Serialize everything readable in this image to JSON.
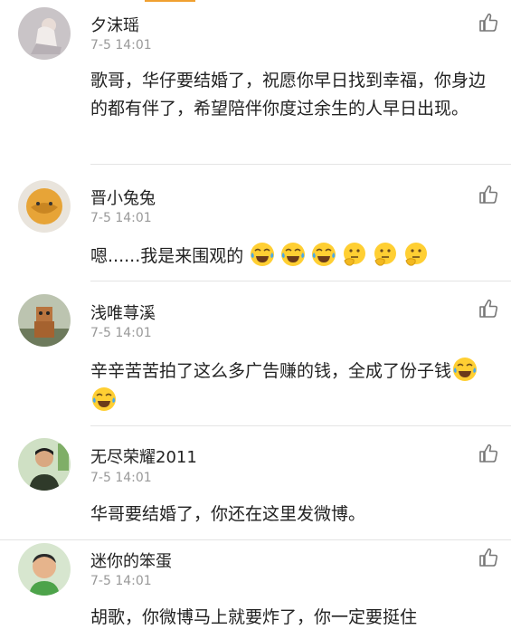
{
  "comments": [
    {
      "name": "夕沫瑶",
      "time": "7-5 14:01",
      "text": "歌哥，华仔要结婚了，祝愿你早日找到幸福，你身边的都有伴了，希望陪伴你度过余生的人早日出现。",
      "avatar_icon": "avatar-girl-sitting"
    },
    {
      "name": "晋小兔兔",
      "time": "7-5 14:01",
      "text": "嗯......我是来围观的",
      "emojis": [
        "laugh-cry-emoji",
        "laugh-cry-emoji",
        "laugh-cry-emoji",
        "thinking-emoji",
        "thinking-emoji",
        "thinking-emoji"
      ],
      "avatar_icon": "avatar-orange-ball"
    },
    {
      "name": "浅唯荨溪",
      "time": "7-5 14:01",
      "text": "辛辛苦苦拍了这么多广告赚的钱，全成了份子钱",
      "emojis": [
        "laugh-cry-emoji",
        "laugh-cry-emoji"
      ],
      "avatar_icon": "avatar-robot-toy"
    },
    {
      "name": "无尽荣耀2011",
      "time": "7-5 14:01",
      "text": "华哥要结婚了，你还在这里发微博。",
      "avatar_icon": "avatar-young-man"
    },
    {
      "name": "迷你的笨蛋",
      "time": "7-5 14:01",
      "text": "胡歌，你微博马上就要炸了，你一定要挺住",
      "avatar_icon": "avatar-child"
    }
  ],
  "colors": {
    "text": "#222222",
    "time": "#999999",
    "separator": "#e4e4e4",
    "accent": "#f0a030"
  },
  "like_icon": "thumbs-up-icon"
}
